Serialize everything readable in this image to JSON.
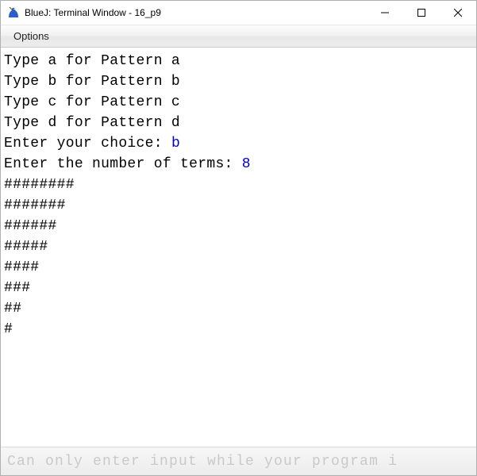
{
  "titlebar": {
    "title": "BlueJ: Terminal Window - 16_p9"
  },
  "menubar": {
    "options": "Options"
  },
  "terminal": {
    "lines": [
      {
        "segments": [
          {
            "t": "Type a for Pattern a",
            "input": false
          }
        ]
      },
      {
        "segments": [
          {
            "t": "Type b for Pattern b",
            "input": false
          }
        ]
      },
      {
        "segments": [
          {
            "t": "Type c for Pattern c",
            "input": false
          }
        ]
      },
      {
        "segments": [
          {
            "t": "Type d for Pattern d",
            "input": false
          }
        ]
      },
      {
        "segments": [
          {
            "t": "Enter your choice: ",
            "input": false
          },
          {
            "t": "b",
            "input": true
          }
        ]
      },
      {
        "segments": [
          {
            "t": "Enter the number of terms: ",
            "input": false
          },
          {
            "t": "8",
            "input": true
          }
        ]
      },
      {
        "segments": [
          {
            "t": "########",
            "input": false
          }
        ]
      },
      {
        "segments": [
          {
            "t": "#######",
            "input": false
          }
        ]
      },
      {
        "segments": [
          {
            "t": "######",
            "input": false
          }
        ]
      },
      {
        "segments": [
          {
            "t": "#####",
            "input": false
          }
        ]
      },
      {
        "segments": [
          {
            "t": "####",
            "input": false
          }
        ]
      },
      {
        "segments": [
          {
            "t": "###",
            "input": false
          }
        ]
      },
      {
        "segments": [
          {
            "t": "##",
            "input": false
          }
        ]
      },
      {
        "segments": [
          {
            "t": "#",
            "input": false
          }
        ]
      }
    ]
  },
  "statusbar": {
    "message": "Can only enter input while your program i"
  }
}
